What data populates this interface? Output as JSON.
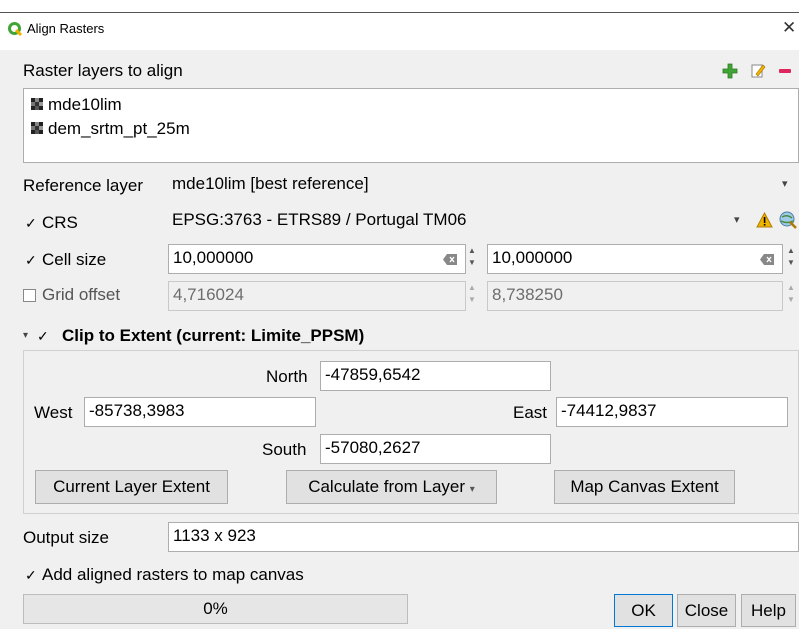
{
  "window": {
    "title": "Align Rasters",
    "close_glyph": "✕"
  },
  "layers_section": {
    "label": "Raster layers to align",
    "items": [
      "mde10lim",
      "dem_srtm_pt_25m"
    ]
  },
  "reference": {
    "label": "Reference layer",
    "value": "mde10lim [best reference]"
  },
  "crs": {
    "label": "CRS",
    "checked": true,
    "value": "EPSG:3763 - ETRS89 / Portugal TM06"
  },
  "cell_size": {
    "label": "Cell size",
    "checked": true,
    "x": "10,000000",
    "y": "10,000000"
  },
  "grid_offset": {
    "label": "Grid offset",
    "checked": false,
    "x": "4,716024",
    "y": "8,738250"
  },
  "clip": {
    "label": "Clip to Extent (current: Limite_PPSM)",
    "checked": true,
    "north_label": "North",
    "north": "-47859,6542",
    "west_label": "West",
    "west": "-85738,3983",
    "east_label": "East",
    "east": "-74412,9837",
    "south_label": "South",
    "south": "-57080,2627",
    "btn_current": "Current Layer Extent",
    "btn_calc": "Calculate from Layer",
    "btn_canvas": "Map Canvas Extent"
  },
  "output": {
    "label": "Output size",
    "value": "1133 x 923"
  },
  "add_to_canvas": {
    "label": "Add aligned rasters to map canvas",
    "checked": true
  },
  "progress": {
    "text": "0%",
    "fraction": 0
  },
  "buttons": {
    "ok": "OK",
    "close": "Close",
    "help": "Help"
  },
  "glyphs": {
    "check": "✓",
    "arrow_down": "▾",
    "up": "▲",
    "down": "▼"
  },
  "colors": {
    "accent_green": "#3fa535",
    "warning": "#f0b400",
    "remove_red": "#e0245e"
  }
}
